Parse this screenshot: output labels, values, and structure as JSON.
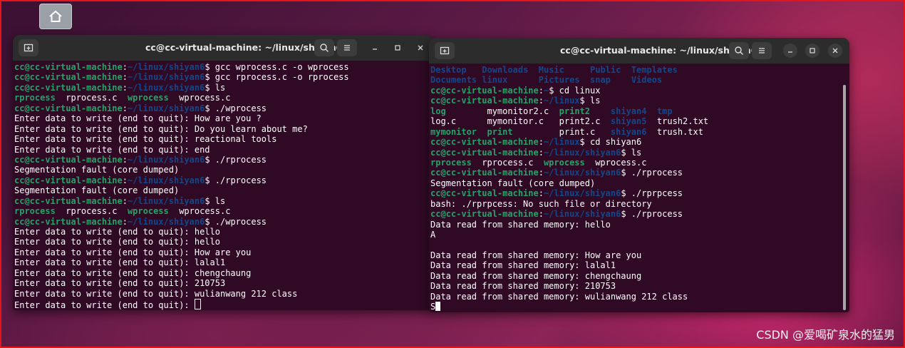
{
  "desktop": {
    "home_icon": "home-icon",
    "watermark": "CSDN @爱喝矿泉水的猛男"
  },
  "colors": {
    "terminal_bg": "#300a24",
    "user": "#26a269",
    "path": "#12488b",
    "border": "#e3151a"
  },
  "left_window": {
    "title": "cc@cc-virtual-machine: ~/linux/shiyan6",
    "lines": [
      [
        {
          "t": "cc@cc-virtual-machine",
          "c": "user"
        },
        {
          "t": ":",
          "c": "text"
        },
        {
          "t": "~/linux/shiyan6",
          "c": "path"
        },
        {
          "t": "$ gcc wprocess.c -o wprocess",
          "c": "text"
        }
      ],
      [
        {
          "t": "cc@cc-virtual-machine",
          "c": "user"
        },
        {
          "t": ":",
          "c": "text"
        },
        {
          "t": "~/linux/shiyan6",
          "c": "path"
        },
        {
          "t": "$ gcc rprocess.c -o rprocess",
          "c": "text"
        }
      ],
      [
        {
          "t": "cc@cc-virtual-machine",
          "c": "user"
        },
        {
          "t": ":",
          "c": "text"
        },
        {
          "t": "~/linux/shiyan6",
          "c": "path"
        },
        {
          "t": "$ ls",
          "c": "text"
        }
      ],
      [
        {
          "t": "rprocess",
          "c": "exe"
        },
        {
          "t": "  rprocess.c  ",
          "c": "text"
        },
        {
          "t": "wprocess",
          "c": "exe"
        },
        {
          "t": "  wprocess.c",
          "c": "text"
        }
      ],
      [
        {
          "t": "cc@cc-virtual-machine",
          "c": "user"
        },
        {
          "t": ":",
          "c": "text"
        },
        {
          "t": "~/linux/shiyan6",
          "c": "path"
        },
        {
          "t": "$ ./wprocess",
          "c": "text"
        }
      ],
      [
        {
          "t": "Enter data to write (end to quit): How are you ?",
          "c": "text"
        }
      ],
      [
        {
          "t": "Enter data to write (end to quit): Do you learn about me?",
          "c": "text"
        }
      ],
      [
        {
          "t": "Enter data to write (end to quit): reactional tools",
          "c": "text"
        }
      ],
      [
        {
          "t": "Enter data to write (end to quit): end",
          "c": "text"
        }
      ],
      [
        {
          "t": "cc@cc-virtual-machine",
          "c": "user"
        },
        {
          "t": ":",
          "c": "text"
        },
        {
          "t": "~/linux/shiyan6",
          "c": "path"
        },
        {
          "t": "$ ./rprocess",
          "c": "text"
        }
      ],
      [
        {
          "t": "Segmentation fault (core dumped)",
          "c": "text"
        }
      ],
      [
        {
          "t": "cc@cc-virtual-machine",
          "c": "user"
        },
        {
          "t": ":",
          "c": "text"
        },
        {
          "t": "~/linux/shiyan6",
          "c": "path"
        },
        {
          "t": "$ ./rprocess",
          "c": "text"
        }
      ],
      [
        {
          "t": "Segmentation fault (core dumped)",
          "c": "text"
        }
      ],
      [
        {
          "t": "cc@cc-virtual-machine",
          "c": "user"
        },
        {
          "t": ":",
          "c": "text"
        },
        {
          "t": "~/linux/shiyan6",
          "c": "path"
        },
        {
          "t": "$ ls",
          "c": "text"
        }
      ],
      [
        {
          "t": "rprocess",
          "c": "exe"
        },
        {
          "t": "  rprocess.c  ",
          "c": "text"
        },
        {
          "t": "wprocess",
          "c": "exe"
        },
        {
          "t": "  wprocess.c",
          "c": "text"
        }
      ],
      [
        {
          "t": "cc@cc-virtual-machine",
          "c": "user"
        },
        {
          "t": ":",
          "c": "text"
        },
        {
          "t": "~/linux/shiyan6",
          "c": "path"
        },
        {
          "t": "$ ./wprocess",
          "c": "text"
        }
      ],
      [
        {
          "t": "Enter data to write (end to quit): hello",
          "c": "text"
        }
      ],
      [
        {
          "t": "Enter data to write (end to quit): hello",
          "c": "text"
        }
      ],
      [
        {
          "t": "Enter data to write (end to quit): How are you",
          "c": "text"
        }
      ],
      [
        {
          "t": "Enter data to write (end to quit): lalal1",
          "c": "text"
        }
      ],
      [
        {
          "t": "Enter data to write (end to quit): chengchaung",
          "c": "text"
        }
      ],
      [
        {
          "t": "Enter data to write (end to quit): 210753",
          "c": "text"
        }
      ],
      [
        {
          "t": "Enter data to write (end to quit): wulianwang 212 class",
          "c": "text"
        }
      ],
      [
        {
          "t": "Enter data to write (end to quit): ",
          "c": "text"
        }
      ]
    ]
  },
  "right_window": {
    "title": "cc@cc-virtual-machine: ~/linux/shiyan6",
    "lines": [
      [
        {
          "t": "Desktop",
          "c": "dir"
        },
        {
          "t": "   ",
          "c": "text"
        },
        {
          "t": "Downloads",
          "c": "dir"
        },
        {
          "t": "  ",
          "c": "text"
        },
        {
          "t": "Music",
          "c": "dir"
        },
        {
          "t": "     ",
          "c": "text"
        },
        {
          "t": "Public",
          "c": "dir"
        },
        {
          "t": "  ",
          "c": "text"
        },
        {
          "t": "Templates",
          "c": "dir"
        }
      ],
      [
        {
          "t": "Documents",
          "c": "dir"
        },
        {
          "t": " ",
          "c": "text"
        },
        {
          "t": "linux",
          "c": "dir"
        },
        {
          "t": "      ",
          "c": "text"
        },
        {
          "t": "Pictures",
          "c": "dir"
        },
        {
          "t": "  ",
          "c": "text"
        },
        {
          "t": "snap",
          "c": "dir"
        },
        {
          "t": "    ",
          "c": "text"
        },
        {
          "t": "Videos",
          "c": "dir"
        }
      ],
      [
        {
          "t": "cc@cc-virtual-machine",
          "c": "user"
        },
        {
          "t": ":",
          "c": "text"
        },
        {
          "t": "~",
          "c": "path"
        },
        {
          "t": "$ cd linux",
          "c": "text"
        }
      ],
      [
        {
          "t": "cc@cc-virtual-machine",
          "c": "user"
        },
        {
          "t": ":",
          "c": "text"
        },
        {
          "t": "~/linux",
          "c": "path"
        },
        {
          "t": "$ ls",
          "c": "text"
        }
      ],
      [
        {
          "t": "log",
          "c": "exe"
        },
        {
          "t": "        mymonitor2.c  ",
          "c": "text"
        },
        {
          "t": "print2",
          "c": "exe"
        },
        {
          "t": "    ",
          "c": "text"
        },
        {
          "t": "shiyan4",
          "c": "dir"
        },
        {
          "t": "  ",
          "c": "text"
        },
        {
          "t": "tmp",
          "c": "dir"
        }
      ],
      [
        {
          "t": "log.c      mymonitor.c   print2.c  ",
          "c": "text"
        },
        {
          "t": "shiyan5",
          "c": "dir"
        },
        {
          "t": "  trush2.txt",
          "c": "text"
        }
      ],
      [
        {
          "t": "mymonitor",
          "c": "exe"
        },
        {
          "t": "  ",
          "c": "text"
        },
        {
          "t": "print",
          "c": "exe"
        },
        {
          "t": "         print.c   ",
          "c": "text"
        },
        {
          "t": "shiyan6",
          "c": "dir"
        },
        {
          "t": "  trush.txt",
          "c": "text"
        }
      ],
      [
        {
          "t": "cc@cc-virtual-machine",
          "c": "user"
        },
        {
          "t": ":",
          "c": "text"
        },
        {
          "t": "~/linux",
          "c": "path"
        },
        {
          "t": "$ cd shiyan6",
          "c": "text"
        }
      ],
      [
        {
          "t": "cc@cc-virtual-machine",
          "c": "user"
        },
        {
          "t": ":",
          "c": "text"
        },
        {
          "t": "~/linux/shiyan6",
          "c": "path"
        },
        {
          "t": "$ ls",
          "c": "text"
        }
      ],
      [
        {
          "t": "rprocess",
          "c": "exe"
        },
        {
          "t": "  rprocess.c  ",
          "c": "text"
        },
        {
          "t": "wprocess",
          "c": "exe"
        },
        {
          "t": "  wprocess.c",
          "c": "text"
        }
      ],
      [
        {
          "t": "cc@cc-virtual-machine",
          "c": "user"
        },
        {
          "t": ":",
          "c": "text"
        },
        {
          "t": "~/linux/shiyan6",
          "c": "path"
        },
        {
          "t": "$ ./rprocess",
          "c": "text"
        }
      ],
      [
        {
          "t": "Segmentation fault (core dumped)",
          "c": "text"
        }
      ],
      [
        {
          "t": "cc@cc-virtual-machine",
          "c": "user"
        },
        {
          "t": ":",
          "c": "text"
        },
        {
          "t": "~/linux/shiyan6",
          "c": "path"
        },
        {
          "t": "$ ./rprpcess",
          "c": "text"
        }
      ],
      [
        {
          "t": "bash: ./rprpcess: No such file or directory",
          "c": "text"
        }
      ],
      [
        {
          "t": "cc@cc-virtual-machine",
          "c": "user"
        },
        {
          "t": ":",
          "c": "text"
        },
        {
          "t": "~/linux/shiyan6",
          "c": "path"
        },
        {
          "t": "$ ./rprocess",
          "c": "text"
        }
      ],
      [
        {
          "t": "Data read from shared memory: hello",
          "c": "text"
        }
      ],
      [
        {
          "t": "A",
          "c": "text"
        }
      ],
      [
        {
          "t": "",
          "c": "text"
        }
      ],
      [
        {
          "t": "Data read from shared memory: How are you",
          "c": "text"
        }
      ],
      [
        {
          "t": "Data read from shared memory: lalal1",
          "c": "text"
        }
      ],
      [
        {
          "t": "Data read from shared memory: chengchaung",
          "c": "text"
        }
      ],
      [
        {
          "t": "Data read from shared memory: 210753",
          "c": "text"
        }
      ],
      [
        {
          "t": "Data read from shared memory: wulianwang 212 class",
          "c": "text"
        }
      ],
      [
        {
          "t": "S",
          "c": "text"
        }
      ]
    ]
  }
}
